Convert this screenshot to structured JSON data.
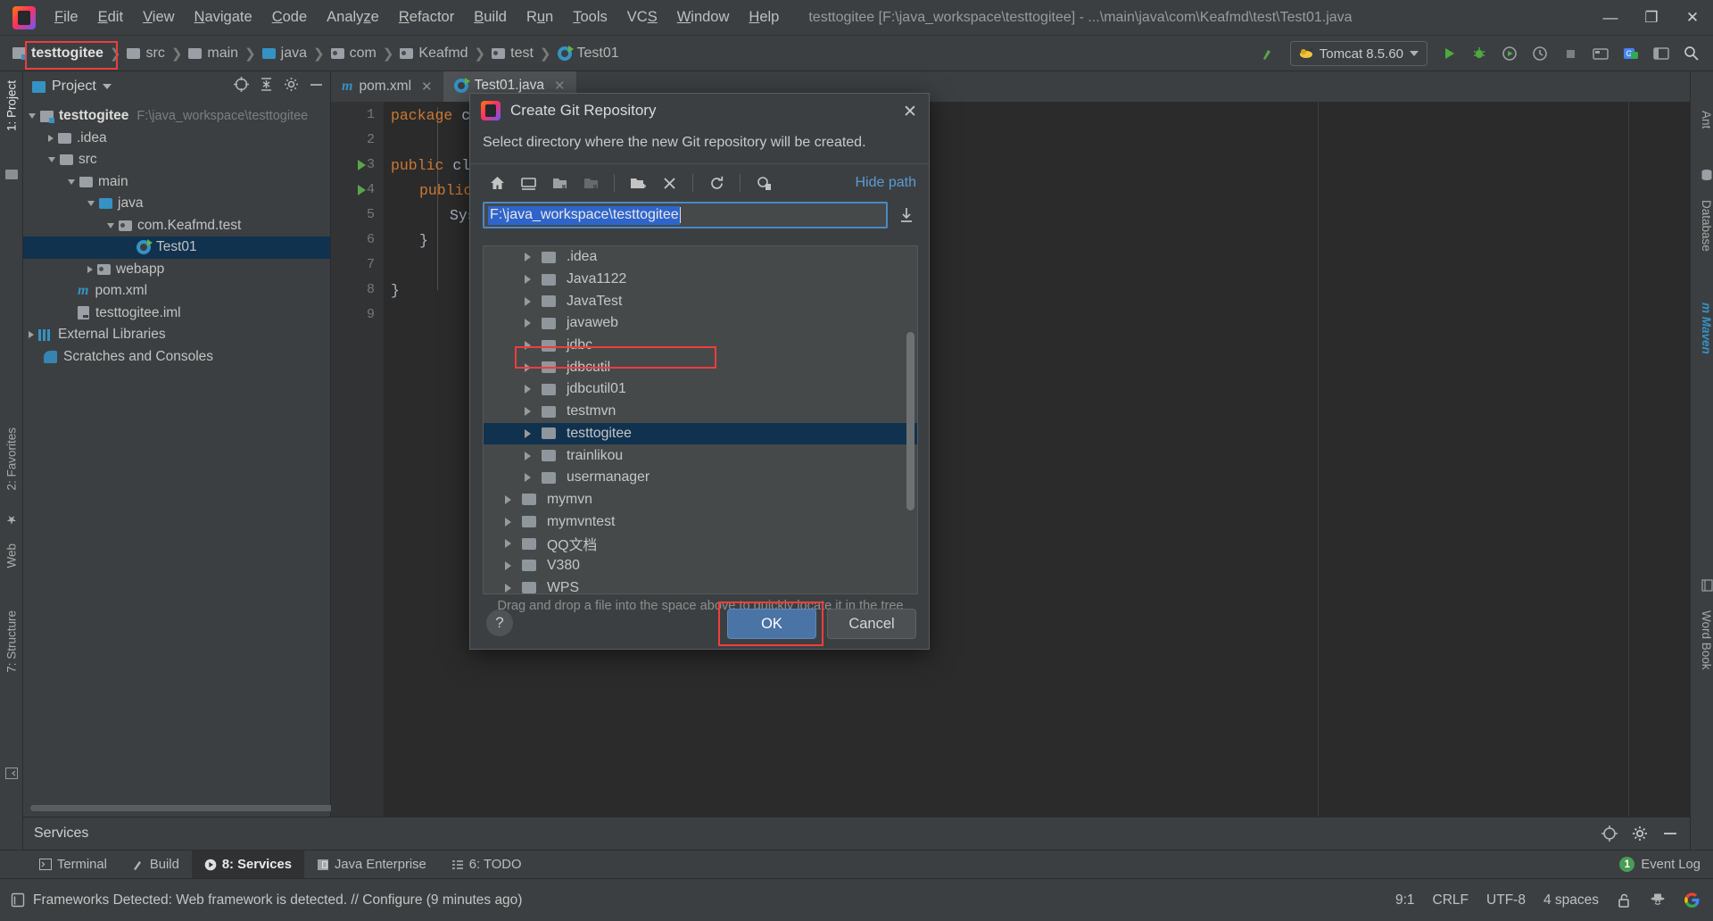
{
  "window": {
    "title": "testtogitee [F:\\java_workspace\\testtogitee] - ...\\main\\java\\com\\Keafmd\\test\\Test01.java",
    "minimize": "—",
    "maximize": "❐",
    "close": "✕"
  },
  "menu": {
    "items": [
      {
        "label": "File"
      },
      {
        "label": "Edit"
      },
      {
        "label": "View"
      },
      {
        "label": "Navigate"
      },
      {
        "label": "Code"
      },
      {
        "label": "Analyze"
      },
      {
        "label": "Refactor"
      },
      {
        "label": "Build"
      },
      {
        "label": "Run"
      },
      {
        "label": "Tools"
      },
      {
        "label": "VCS"
      },
      {
        "label": "Window"
      },
      {
        "label": "Help"
      }
    ]
  },
  "breadcrumbs": [
    {
      "label": "testtogitee",
      "icon": "module-icon"
    },
    {
      "label": "src",
      "icon": "folder-icon"
    },
    {
      "label": "main",
      "icon": "folder-icon"
    },
    {
      "label": "java",
      "icon": "source-folder-icon"
    },
    {
      "label": "com",
      "icon": "package-icon"
    },
    {
      "label": "Keafmd",
      "icon": "package-icon"
    },
    {
      "label": "test",
      "icon": "package-icon"
    },
    {
      "label": "Test01",
      "icon": "java-class-icon"
    }
  ],
  "toolbar": {
    "run_config": "Tomcat 8.5.60",
    "build_icon": "hammer-icon",
    "run_icon": "run-icon",
    "debug_icon": "debug-icon",
    "run_coverage_icon": "run-with-coverage-icon",
    "profiler_icon": "profiler-icon",
    "stop_icon": "stop-icon",
    "updates_icon": "updates-icon",
    "translate_icon": "translate-icon",
    "layout_icon": "layout-icon",
    "search_icon": "search-icon"
  },
  "left_strip": [
    {
      "label": "1: Project",
      "selected": true
    },
    {
      "label": "2: Favorites",
      "selected": false
    },
    {
      "label": "Web",
      "selected": false
    },
    {
      "label": "7: Structure",
      "selected": false
    }
  ],
  "right_strip": [
    {
      "label": "Ant"
    },
    {
      "label": "Database"
    },
    {
      "label": "m Maven"
    },
    {
      "label": "Word Book"
    }
  ],
  "project_panel": {
    "title": "Project",
    "actions": [
      "locate-icon",
      "collapse-all-icon",
      "settings-icon",
      "hide-icon"
    ],
    "tree": [
      {
        "label": "testtogitee",
        "path": "F:\\java_workspace\\testtogitee",
        "indent": 0,
        "toggle": "open",
        "icon": "module-icon",
        "bold": true,
        "selected": false
      },
      {
        "label": ".idea",
        "path": "",
        "indent": 1,
        "toggle": "closed",
        "icon": "folder-icon",
        "bold": false,
        "selected": false
      },
      {
        "label": "src",
        "path": "",
        "indent": 1,
        "toggle": "open",
        "icon": "folder-icon",
        "bold": false,
        "selected": false
      },
      {
        "label": "main",
        "path": "",
        "indent": 2,
        "toggle": "open",
        "icon": "folder-icon",
        "bold": false,
        "selected": false
      },
      {
        "label": "java",
        "path": "",
        "indent": 3,
        "toggle": "open",
        "icon": "source-folder-icon",
        "bold": false,
        "selected": false
      },
      {
        "label": "com.Keafmd.test",
        "path": "",
        "indent": 4,
        "toggle": "open",
        "icon": "package-icon",
        "bold": false,
        "selected": false
      },
      {
        "label": "Test01",
        "path": "",
        "indent": 5,
        "toggle": "none",
        "icon": "java-class-icon",
        "bold": false,
        "selected": true
      },
      {
        "label": "webapp",
        "path": "",
        "indent": 3,
        "toggle": "closed",
        "icon": "webapp-folder-icon",
        "bold": false,
        "selected": false
      },
      {
        "label": "pom.xml",
        "path": "",
        "indent": 2,
        "toggle": "none",
        "icon": "maven-icon",
        "bold": false,
        "selected": false
      },
      {
        "label": "testtogitee.iml",
        "path": "",
        "indent": 2,
        "toggle": "none",
        "icon": "iml-icon",
        "bold": false,
        "selected": false
      },
      {
        "label": "External Libraries",
        "path": "",
        "indent": 0,
        "toggle": "closed",
        "icon": "library-icon",
        "bold": false,
        "selected": false
      },
      {
        "label": "Scratches and Consoles",
        "path": "",
        "indent": 0,
        "toggle": "none",
        "icon": "scratches-icon",
        "bold": false,
        "selected": false
      }
    ]
  },
  "editor": {
    "tabs": [
      {
        "label": "pom.xml",
        "icon": "maven-icon",
        "active": false
      },
      {
        "label": "Test01.java",
        "icon": "java-class-icon",
        "active": true
      }
    ],
    "line_numbers": [
      "1",
      "2",
      "3",
      "4",
      "5",
      "6",
      "7",
      "8",
      "9"
    ],
    "lines": [
      {
        "n": 1,
        "text": "package com",
        "kw": "package",
        "rest": " com"
      },
      {
        "n": 3,
        "text": "public clas",
        "kw": "public",
        "rest": " clas"
      },
      {
        "n": 4,
        "text": "public",
        "kw": "public",
        "rest": ""
      },
      {
        "n": 5,
        "text": "Sys",
        "kw": "",
        "rest": "Sys"
      },
      {
        "n": 6,
        "text": "}",
        "kw": "",
        "rest": "}"
      },
      {
        "n": 8,
        "text": "}",
        "kw": "",
        "rest": "}"
      }
    ],
    "run_markers": [
      3,
      4
    ]
  },
  "dialog": {
    "title": "Create Git Repository",
    "icon": "intellij-idea-icon",
    "close_icon": "close-icon",
    "description": "Select directory where the new Git repository will be created.",
    "toolbar": [
      {
        "name": "home-icon"
      },
      {
        "name": "desktop-icon"
      },
      {
        "name": "project-folder-icon"
      },
      {
        "name": "module-folder-icon"
      },
      {
        "name": "new-folder-icon"
      },
      {
        "name": "delete-icon"
      },
      {
        "name": "refresh-icon"
      },
      {
        "name": "show-hidden-icon"
      }
    ],
    "hide_path_label": "Hide path",
    "path_value": "F:\\java_workspace\\testtogitee",
    "path_selected": true,
    "download_icon": "collapse-path-icon",
    "tree": [
      {
        "label": ".idea",
        "indent": 1,
        "selected": false
      },
      {
        "label": "Java1122",
        "indent": 1,
        "selected": false
      },
      {
        "label": "JavaTest",
        "indent": 1,
        "selected": false
      },
      {
        "label": "javaweb",
        "indent": 1,
        "selected": false
      },
      {
        "label": "jdbc",
        "indent": 1,
        "selected": false
      },
      {
        "label": "jdbcutil",
        "indent": 1,
        "selected": false
      },
      {
        "label": "jdbcutil01",
        "indent": 1,
        "selected": false
      },
      {
        "label": "testmvn",
        "indent": 1,
        "selected": false
      },
      {
        "label": "testtogitee",
        "indent": 1,
        "selected": true
      },
      {
        "label": "trainlikou",
        "indent": 1,
        "selected": false
      },
      {
        "label": "usermanager",
        "indent": 1,
        "selected": false
      },
      {
        "label": "mymvn",
        "indent": 0,
        "selected": false
      },
      {
        "label": "mymvntest",
        "indent": 0,
        "selected": false
      },
      {
        "label": "QQ文档",
        "indent": 0,
        "selected": false
      },
      {
        "label": "V380",
        "indent": 0,
        "selected": false
      },
      {
        "label": "WPS",
        "indent": 0,
        "selected": false
      }
    ],
    "drag_hint": "Drag and drop a file into the space above to quickly locate it in the tree",
    "help_label": "?",
    "ok_label": "OK",
    "cancel_label": "Cancel"
  },
  "services_panel": {
    "title": "Services",
    "actions": [
      "settings-gear-icon",
      "options-icon",
      "hide-icon"
    ]
  },
  "bottom_tabs": [
    {
      "label": "Terminal",
      "icon": "terminal-icon",
      "active": false
    },
    {
      "label": "Build",
      "icon": "build-icon",
      "active": false
    },
    {
      "label": "8: Services",
      "icon": "services-icon",
      "active": true
    },
    {
      "label": "Java Enterprise",
      "icon": "java-enterprise-icon",
      "active": false
    },
    {
      "label": "6: TODO",
      "icon": "todo-icon",
      "active": false
    }
  ],
  "event_log": {
    "count": "1",
    "label": "Event Log"
  },
  "status_bar": {
    "message": "Frameworks Detected: Web framework is detected. // Configure (9 minutes ago)",
    "message_icon": "notification-icon",
    "caret": "9:1",
    "line_separator": "CRLF",
    "encoding": "UTF-8",
    "indent": "4 spaces",
    "lock_icon": "unlocked-icon",
    "hat_icon": "hector-icon",
    "google_icon": "google-icon"
  },
  "colors": {
    "accent_blue": "#3592c4",
    "selection_blue": "#10324f",
    "annotation_red": "#f03d3d",
    "primary_button": "#4a73a6",
    "panel_bg": "#3c3f41",
    "editor_bg": "#2b2b2b"
  }
}
